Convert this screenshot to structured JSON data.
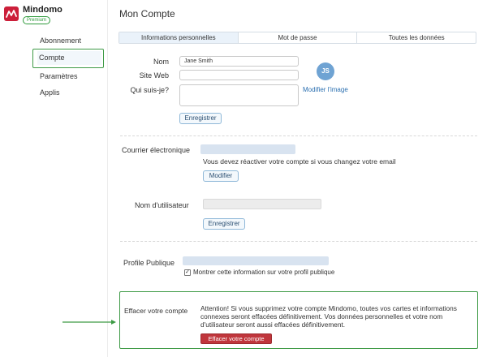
{
  "brand": {
    "name": "Mindomo",
    "plan": "Premium"
  },
  "sidebar": {
    "items": [
      {
        "label": "Abonnement"
      },
      {
        "label": "Compte"
      },
      {
        "label": "Paramètres"
      },
      {
        "label": "Applis"
      }
    ],
    "active": "Compte"
  },
  "page": {
    "title": "Mon Compte"
  },
  "tabs": [
    {
      "label": "Informations personnelles"
    },
    {
      "label": "Mot de passe"
    },
    {
      "label": "Toutes les données"
    }
  ],
  "profile": {
    "name_label": "Nom",
    "name_value": "Jane Smith",
    "website_label": "Site Web",
    "website_value": "",
    "about_label": "Qui suis-je?",
    "about_value": "",
    "avatar_initials": "JS",
    "change_image": "Modifier l'image",
    "save_button": "Enregistrer"
  },
  "email": {
    "label": "Courrier électronique",
    "note": "Vous devez réactiver votre compte si vous changez votre email",
    "modify_button": "Modifier"
  },
  "username": {
    "label": "Nom d'utilisateur",
    "save_button": "Enregistrer"
  },
  "public_profile": {
    "label": "Profile Publique",
    "checkbox_checked": true,
    "checkbox_label": "Montrer cette information sur votre profil publique"
  },
  "delete_account": {
    "label": "Effacer votre compte",
    "warning": "Attention! Si vous supprimez votre compte Mindomo, toutes vos cartes et informations connexes seront effacées définitivement. Vos données personnelles et votre nom d'utilisateur seront aussi effacées définitivement.",
    "button": "Effacer votre compte"
  },
  "colors": {
    "highlight_border": "#3d9a45",
    "danger": "#c0363c",
    "accent": "#2a6fb0",
    "brand": "#cc1f3a"
  }
}
